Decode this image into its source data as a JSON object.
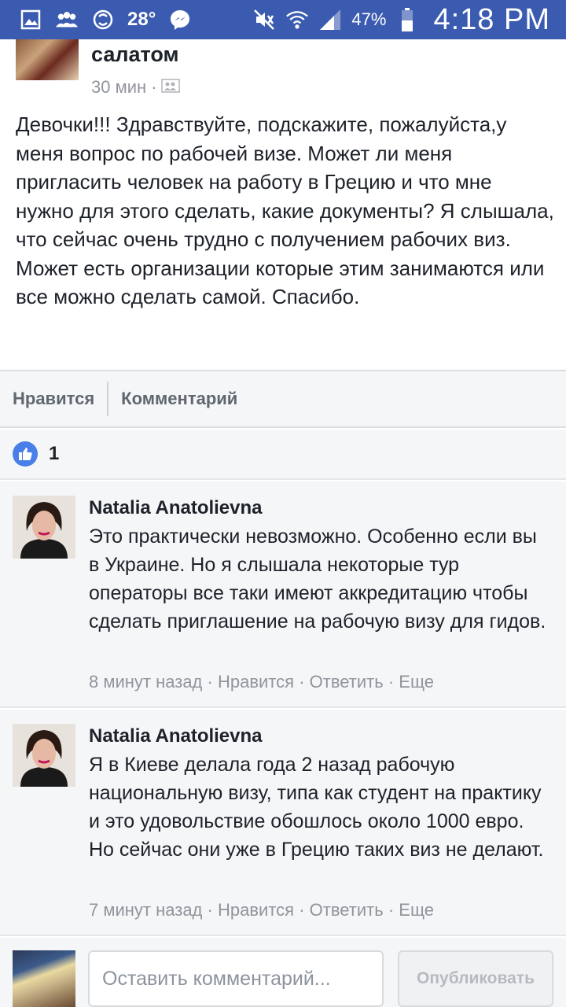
{
  "status_bar": {
    "temperature": "28°",
    "battery_percent": "47%",
    "time": "4:18 PM",
    "color": "#3b5bb0"
  },
  "post": {
    "title": "салатом",
    "time": "30 мин",
    "separator": "·",
    "audience_icon": "friends-icon",
    "body": "Девочки!!! Здравствуйте, подскажите, пожалуйста,у меня вопрос по рабочей визе. Может ли меня пригласить человек на работу в Грецию и что мне нужно для этого сделать, какие документы? Я слышала, что сейчас очень трудно с получением рабочих виз. Может есть организации которые этим занимаются или все можно сделать самой. Спасибо."
  },
  "actions": {
    "like_label": "Нравится",
    "comment_label": "Комментарий"
  },
  "reactions": {
    "icon": "thumbs-up-icon",
    "count": "1",
    "color": "#4a7ee8"
  },
  "comments": [
    {
      "author": "Natalia Anatolievna",
      "text": "Это практически невозможно. Особенно если вы в Украине. Но я слышала некоторые тур операторы все таки имеют аккредитацию чтобы сделать приглашение на рабочую визу для гидов.",
      "time": "8 минут назад",
      "like": "Нравится",
      "reply": "Ответить",
      "more": "Еще"
    },
    {
      "author": "Natalia Anatolievna",
      "text": "Я в Киеве делала года 2 назад рабочую национальную визу, типа как студент на практику и это удовольствие обошлось около 1000 евро. Но сейчас они уже в Грецию таких виз не делают.",
      "time": "7 минут назад",
      "like": "Нравится",
      "reply": "Ответить",
      "more": "Еще"
    }
  ],
  "composer": {
    "placeholder": "Оставить комментарий...",
    "publish_label": "Опубликовать"
  }
}
